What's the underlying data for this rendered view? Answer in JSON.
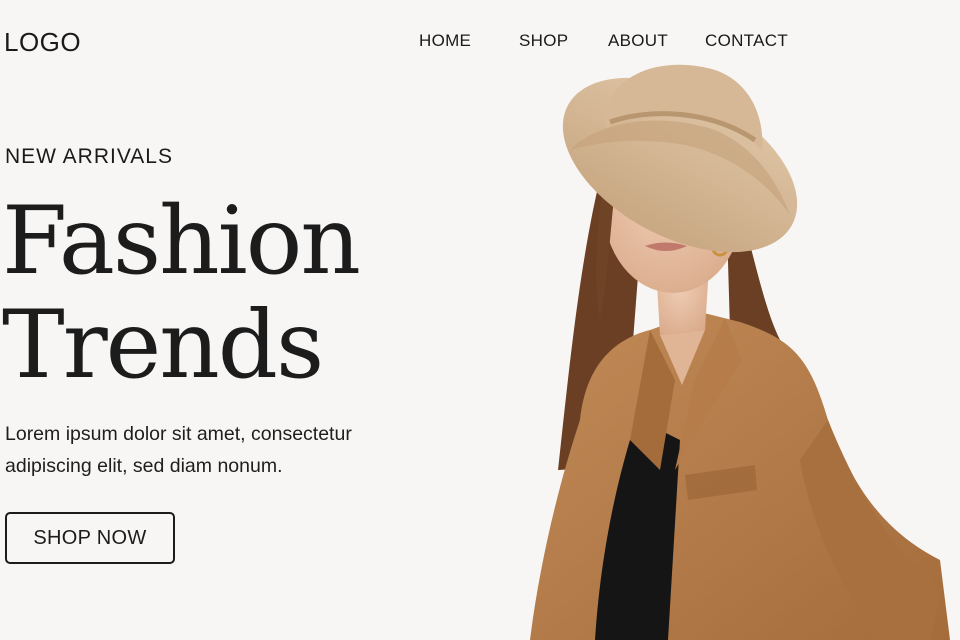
{
  "header": {
    "logo": "LOGO",
    "nav": [
      {
        "label": "HOME"
      },
      {
        "label": "SHOP"
      },
      {
        "label": "ABOUT"
      },
      {
        "label": "CONTACT"
      }
    ]
  },
  "hero": {
    "eyebrow": "NEW ARRIVALS",
    "title_line1": "Fashion",
    "title_line2": "Trends",
    "description_line1": "Lorem ipsum dolor sit amet, consectetur",
    "description_line2": "adipiscing elit, sed diam nonum.",
    "cta_label": "SHOP NOW",
    "photo_icon": "model-photo-icon"
  },
  "colors": {
    "background": "#f8f6f4",
    "text": "#1c1c1c",
    "accent": "#b07a4a"
  }
}
